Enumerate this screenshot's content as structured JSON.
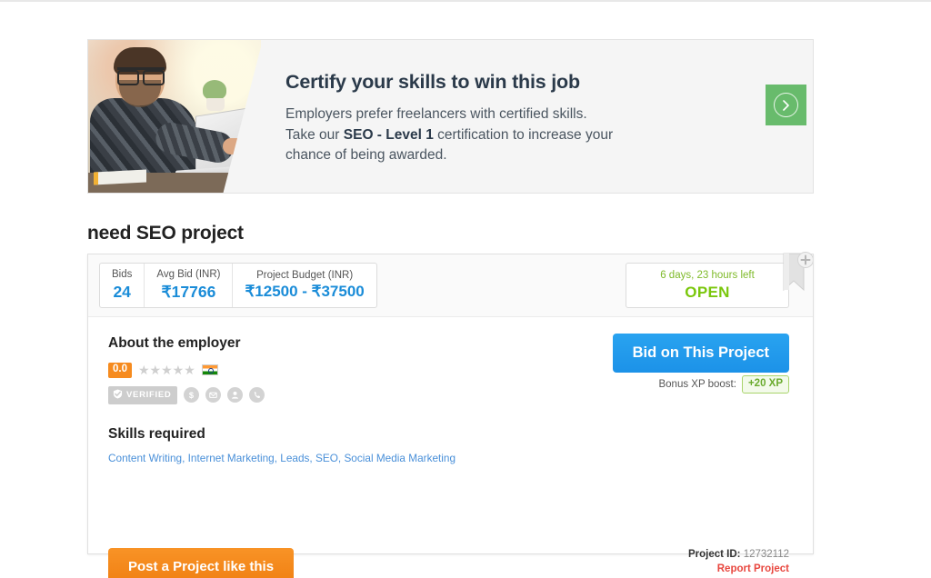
{
  "banner": {
    "title": "Certify your skills to win this job",
    "line1": "Employers prefer freelancers with certified skills.",
    "line2_pre": "Take our ",
    "line2_bold": "SEO - Level 1",
    "line2_post": " certification to increase your",
    "line3": "chance of being awarded.",
    "cta_icon": "chevron-right-icon"
  },
  "project": {
    "title": "need SEO project",
    "stats": [
      {
        "label": "Bids",
        "value": "24"
      },
      {
        "label": "Avg Bid (INR)",
        "value": "₹17766"
      },
      {
        "label": "Project Budget (INR)",
        "value": "₹12500 - ₹37500"
      }
    ],
    "status": {
      "time_left": "6 days, 23 hours left",
      "state": "OPEN"
    },
    "bookmark_icon": "bookmark-add-icon",
    "project_id_label": "Project ID:",
    "project_id": "12732112",
    "report_label": "Report Project"
  },
  "employer": {
    "heading": "About the employer",
    "rating_score": "0.0",
    "stars": "★★★★★",
    "country_icon": "india-flag-icon",
    "verified_label": "VERIFIED",
    "badges": [
      {
        "icon": "payment-verified-icon",
        "glyph": "$"
      },
      {
        "icon": "email-verified-icon",
        "glyph": "✉"
      },
      {
        "icon": "identity-verified-icon",
        "glyph": "●"
      },
      {
        "icon": "phone-verified-icon",
        "glyph": "☎"
      }
    ]
  },
  "skills": {
    "heading": "Skills required",
    "items": [
      "Content Writing",
      "Internet Marketing",
      "Leads",
      "SEO",
      "Social Media Marketing"
    ],
    "text": "Content Writing, Internet Marketing, Leads, SEO, Social Media Marketing"
  },
  "actions": {
    "bid_label": "Bid on This Project",
    "post_label": "Post a Project like this",
    "xp_label": "Bonus XP boost:",
    "xp_value": "+20 XP"
  },
  "colors": {
    "primary_blue": "#1a8cd8",
    "orange": "#f68b1f",
    "green": "#7ac70c",
    "banner_green": "#68bb6c",
    "link_blue": "#4a90d9",
    "report_red": "#e8473f"
  }
}
